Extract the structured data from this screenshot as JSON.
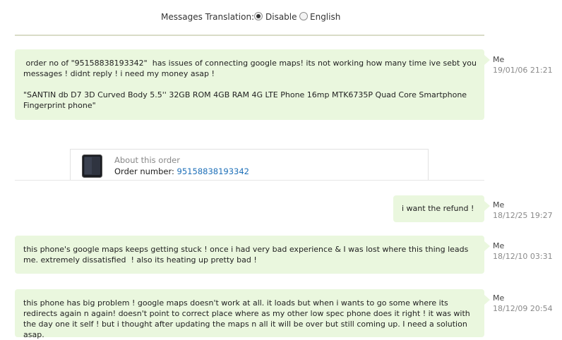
{
  "translation": {
    "label": "Messages Translation:",
    "options": [
      {
        "label": "Disable",
        "selected": true
      },
      {
        "label": "English",
        "selected": false
      }
    ]
  },
  "messages": [
    {
      "text": " order no of \"95158838193342\"  has issues of connecting google maps! its not working how many time ive sebt you messages ! didnt reply ! i need my money asap !\n\n\"SANTIN db D7 3D Curved Body 5.5'' 32GB ROM 4GB RAM 4G LTE Phone 16mp MTK6735P Quad Core Smartphone Fingerprint phone\"",
      "sender": "Me",
      "timestamp": "19/01/06 21:21"
    },
    {
      "text": "i want the refund !",
      "sender": "Me",
      "timestamp": "18/12/25 19:27"
    },
    {
      "text": "this phone's google maps keeps getting stuck ! once i had very bad experience & I was lost where this thing leads me. extremely dissatisfied  ! also its heating up pretty bad !",
      "sender": "Me",
      "timestamp": "18/12/10 03:31"
    },
    {
      "text": "this phone has big problem ! google maps doesn't work at all. it loads but when i wants to go some where its redirects again n again! doesn't point to correct place where as my other low spec phone does it right ! it was with the day one it self ! but i thought after updating the maps n all it will be over but still coming up. I need a solution asap.",
      "sender": "Me",
      "timestamp": "18/12/09 20:54"
    }
  ],
  "order": {
    "heading": "About this order",
    "number_label": "Order number: ",
    "number": "95158838193342",
    "thumbnail_icon": "phone-icon"
  },
  "colors": {
    "bubble": "#eaf7de",
    "link": "#1d6fb8",
    "divider": "#d9dcc7"
  }
}
